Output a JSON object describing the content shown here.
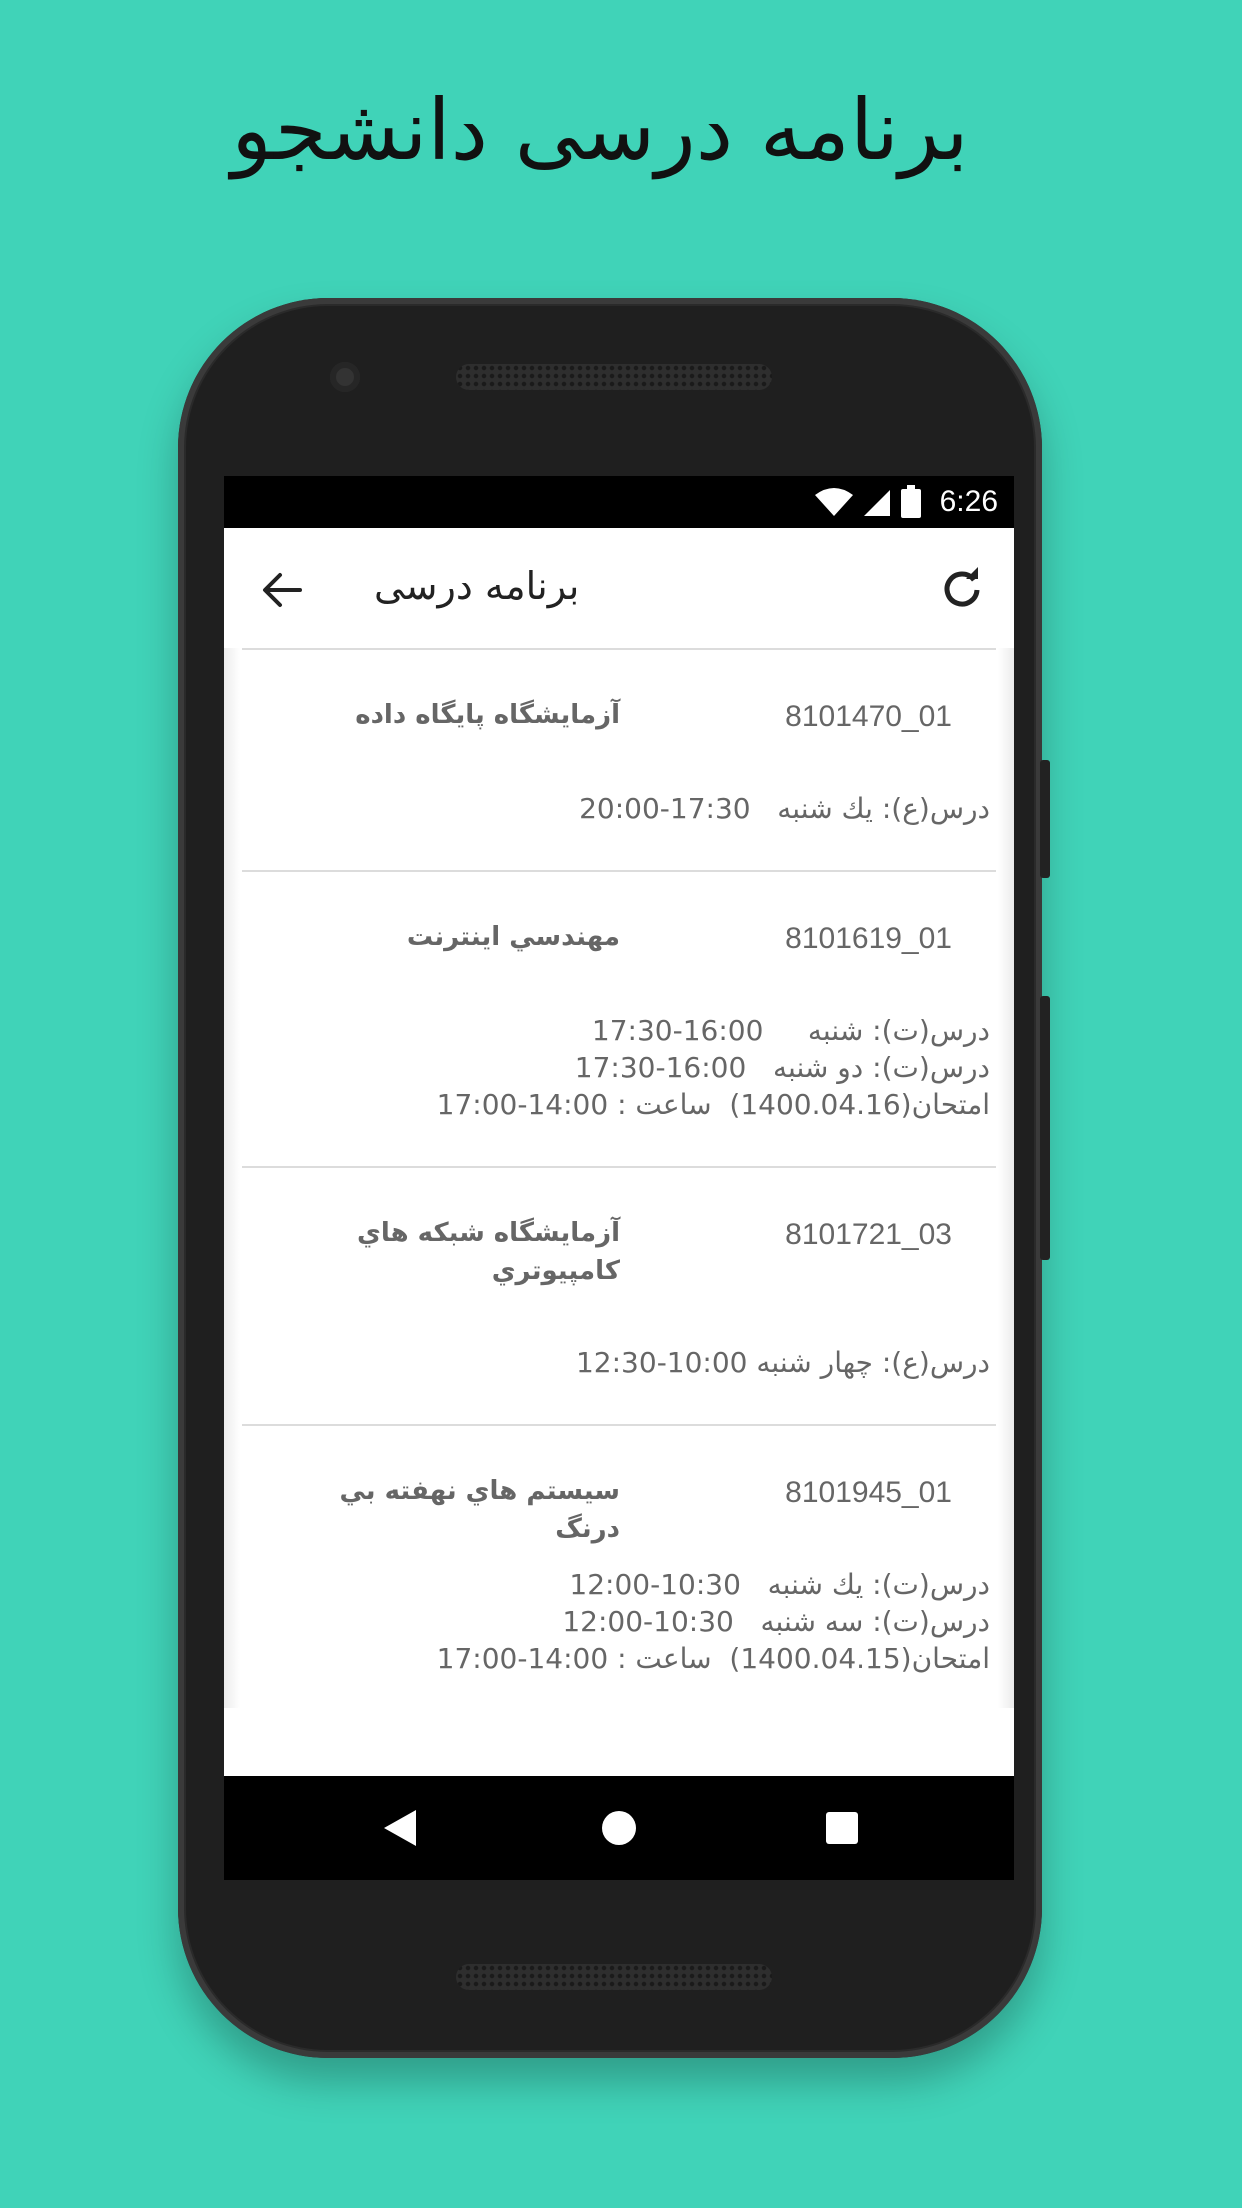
{
  "promo": {
    "title": "برنامه درسی دانشجو"
  },
  "status_bar": {
    "time": "6:26"
  },
  "app_bar": {
    "title": "برنامه درسی"
  },
  "courses": [
    {
      "code": "8101470_01",
      "name": "آزمايشگاه پايگاه داده",
      "sessions": [
        "درس(ع): يك شنبه   17:30-20:00"
      ]
    },
    {
      "code": "8101619_01",
      "name": "مهندسي اينترنت",
      "sessions": [
        "درس(ت): شنبه     16:00-17:30",
        "درس(ت): دو شنبه   16:00-17:30",
        "امتحان(1400.04.16)  ساعت : 14:00-17:00"
      ]
    },
    {
      "code": "8101721_03",
      "name": "آزمايشگاه شبكه هاي كامپيوتري",
      "sessions": [
        "درس(ع): چهار شنبه 10:00-12:30"
      ]
    },
    {
      "code": "8101945_01",
      "name": "سيستم هاي نهفته بي درنگ",
      "sessions": [
        "درس(ت): يك شنبه   10:30-12:00",
        "درس(ت): سه شنبه   10:30-12:00",
        "امتحان(1400.04.15)  ساعت : 14:00-17:00"
      ]
    }
  ],
  "icons": {
    "back": "arrow-back-icon",
    "refresh": "refresh-icon",
    "wifi": "wifi-icon",
    "signal": "signal-icon",
    "battery": "battery-icon",
    "nav_back": "nav-back-icon",
    "nav_home": "nav-home-icon",
    "nav_recents": "nav-recents-icon"
  },
  "colors": {
    "background": "#40d3b8",
    "text_secondary": "#666666"
  }
}
